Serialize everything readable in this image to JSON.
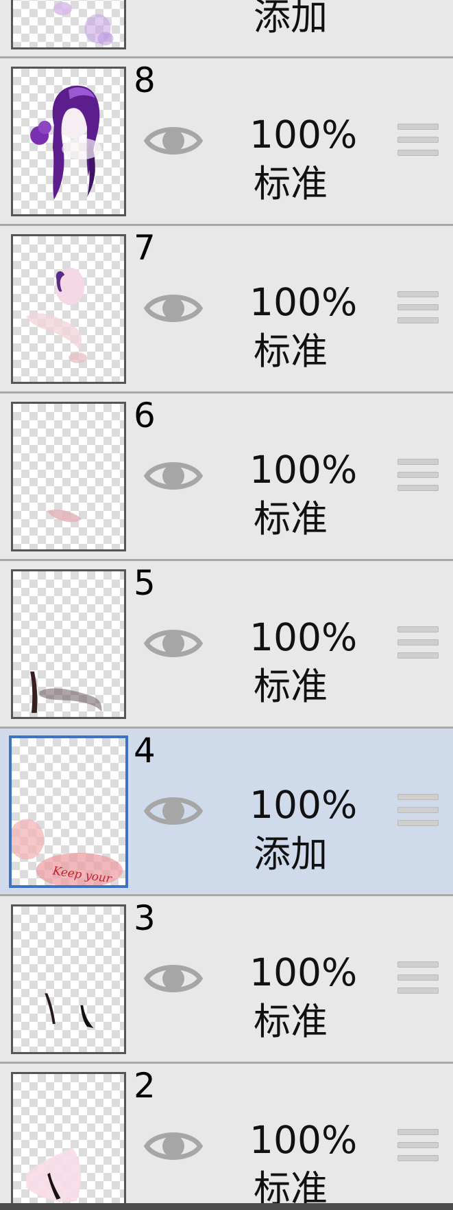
{
  "layers_panel": {
    "layers": [
      {
        "number": "",
        "opacity": "",
        "blend_mode": "添加",
        "visible": true,
        "selected": false,
        "thumb": "purple-blur-top"
      },
      {
        "number": "8",
        "opacity": "100%",
        "blend_mode": "标准",
        "visible": true,
        "selected": false,
        "thumb": "purple-hair-head"
      },
      {
        "number": "7",
        "opacity": "100%",
        "blend_mode": "标准",
        "visible": true,
        "selected": false,
        "thumb": "pink-face"
      },
      {
        "number": "6",
        "opacity": "100%",
        "blend_mode": "标准",
        "visible": true,
        "selected": false,
        "thumb": "pink-stroke"
      },
      {
        "number": "5",
        "opacity": "100%",
        "blend_mode": "标准",
        "visible": true,
        "selected": false,
        "thumb": "dark-hair-strands"
      },
      {
        "number": "4",
        "opacity": "100%",
        "blend_mode": "添加",
        "visible": true,
        "selected": true,
        "thumb": "red-glow-text"
      },
      {
        "number": "3",
        "opacity": "100%",
        "blend_mode": "标准",
        "visible": true,
        "selected": false,
        "thumb": "black-strokes"
      },
      {
        "number": "2",
        "opacity": "100%",
        "blend_mode": "标准",
        "visible": true,
        "selected": false,
        "thumb": "pink-shape"
      }
    ]
  },
  "thumb_texts": {
    "keep_your": "Keep your"
  },
  "colors": {
    "panel_bg": "#e8e8e8",
    "selected_bg": "#cfdaeb",
    "selected_border": "#3d72c4",
    "eye_icon": "#a6a6a6",
    "divider": "#a8a8a8"
  }
}
